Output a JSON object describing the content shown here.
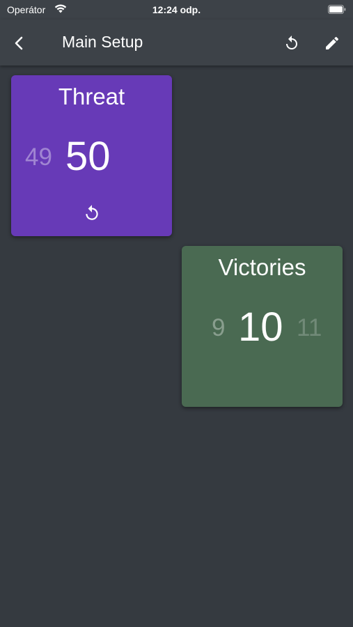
{
  "status_bar": {
    "carrier": "Operátor",
    "time": "12:24 odp."
  },
  "app_bar": {
    "title": "Main Setup",
    "icons": [
      "back-arrow-icon",
      "reset-icon",
      "pencil-icon"
    ]
  },
  "counters": [
    {
      "title": "Threat",
      "previous": "49",
      "value": "50",
      "next": "",
      "color": "#673ab7",
      "has_reset": true
    },
    {
      "title": "Victories",
      "previous": "9",
      "value": "10",
      "next": "11",
      "color": "#4a6a52",
      "has_reset": false
    }
  ],
  "colors": {
    "background": "#353a40",
    "app_bar": "#3d4248"
  }
}
